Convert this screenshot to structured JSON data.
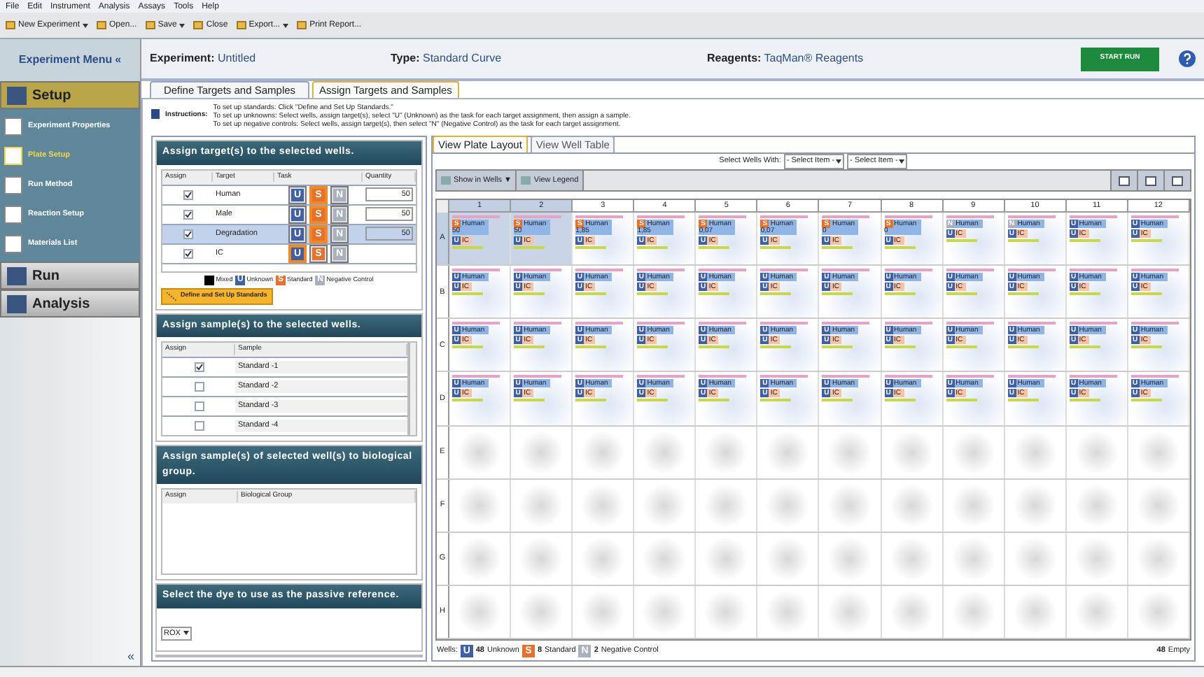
{
  "menu_bar": [
    "File",
    "Edit",
    "Instrument",
    "Analysis",
    "Assays",
    "Tools",
    "Help"
  ],
  "toolbar": [
    {
      "label": "New Experiment",
      "dropdown": true
    },
    {
      "label": "Open...",
      "dropdown": false
    },
    {
      "label": "Save",
      "dropdown": true
    },
    {
      "label": "Close",
      "dropdown": false
    },
    {
      "label": "Export...",
      "dropdown": true
    },
    {
      "label": "Print Report...",
      "dropdown": false
    }
  ],
  "sidebar": {
    "title": "Experiment Menu",
    "collapse": "«",
    "sections": [
      {
        "label": "Setup",
        "expanded": true,
        "items": [
          {
            "label": "Experiment Properties",
            "selected": false
          },
          {
            "label": "Plate Setup",
            "selected": true
          },
          {
            "label": "Run Method",
            "selected": false
          },
          {
            "label": "Reaction Setup",
            "selected": false
          },
          {
            "label": "Materials List",
            "selected": false
          }
        ]
      },
      {
        "label": "Run",
        "expanded": false
      },
      {
        "label": "Analysis",
        "expanded": false
      }
    ],
    "bottom_collapse": "«"
  },
  "header": {
    "experiment_label": "Experiment:",
    "experiment": "Untitled",
    "type_label": "Type:",
    "type": "Standard Curve",
    "reagents_label": "Reagents:",
    "reagents": "TaqMan® Reagents",
    "start_button": "START RUN"
  },
  "tabs": [
    {
      "label": "Define Targets and Samples",
      "selected": false
    },
    {
      "label": "Assign Targets and Samples",
      "selected": true
    }
  ],
  "instructions": {
    "label": "Instructions:",
    "lines": [
      "To set up standards: Click \"Define and Set Up Standards.\"",
      "To set up unknowns: Select wells, assign target(s), select \"U\" (Unknown) as the task for each target assignment, then assign a sample.",
      "To set up negative controls: Select wells, assign target(s), then select \"N\" (Negative Control) as the task for each target assignment."
    ]
  },
  "targets": {
    "title": "Assign target(s) to the selected wells.",
    "columns": [
      "Assign",
      "Target",
      "Task",
      "Quantity"
    ],
    "rows": [
      {
        "checked": true,
        "target": "Human",
        "tasks": [
          {
            "letter": "U",
            "selected": false
          },
          {
            "letter": "S",
            "selected": true
          },
          {
            "letter": "N",
            "selected": false
          }
        ],
        "quantity": "50",
        "selected": false
      },
      {
        "checked": true,
        "target": "Male",
        "tasks": [
          {
            "letter": "U",
            "selected": false
          },
          {
            "letter": "S",
            "selected": true
          },
          {
            "letter": "N",
            "selected": false
          }
        ],
        "quantity": "50",
        "selected": false
      },
      {
        "checked": true,
        "target": "Degradation",
        "tasks": [
          {
            "letter": "U",
            "selected": false
          },
          {
            "letter": "S",
            "selected": true
          },
          {
            "letter": "N",
            "selected": false
          }
        ],
        "quantity": "50",
        "selected": true
      },
      {
        "checked": true,
        "target": "IC",
        "tasks": [
          {
            "letter": "U",
            "selected": true
          },
          {
            "letter": "S",
            "selected": false
          },
          {
            "letter": "N",
            "selected": false
          }
        ],
        "selected": false
      }
    ],
    "legend": [
      {
        "kind": "mixed",
        "label": "Mixed"
      },
      {
        "kind": "U",
        "letter": "U",
        "label": "Unknown"
      },
      {
        "kind": "S",
        "letter": "S",
        "label": "Standard"
      },
      {
        "kind": "N",
        "letter": "N",
        "label": "Negative Control"
      }
    ],
    "button": "Define and Set Up Standards"
  },
  "samples": {
    "title": "Assign sample(s) to the selected wells.",
    "columns": [
      "Assign",
      "Sample"
    ],
    "rows": [
      {
        "checked": true,
        "sample": "Standard -1"
      },
      {
        "checked": false,
        "sample": "Standard -2"
      },
      {
        "checked": false,
        "sample": "Standard -3"
      },
      {
        "checked": false,
        "sample": "Standard -4"
      }
    ]
  },
  "bio_group": {
    "title": "Assign sample(s) of selected well(s) to biological group.",
    "columns": [
      "Assign",
      "Biological Group"
    ]
  },
  "dye": {
    "title": "Select the dye to use as the passive reference.",
    "value": "ROX"
  },
  "plate_tabs": [
    {
      "label": "View Plate Layout",
      "selected": true
    },
    {
      "label": "View Well Table",
      "selected": false
    }
  ],
  "select_wells": {
    "label": "Select Wells With:",
    "dropdowns": [
      "- Select Item -",
      "- Select Item -"
    ]
  },
  "plate_toolbar": [
    "Show in Wells ▼",
    "View Legend"
  ],
  "plate": {
    "columns": [
      {
        "label": "1",
        "selected": true
      },
      {
        "label": "2",
        "selected": true
      },
      {
        "label": "3",
        "selected": false
      },
      {
        "label": "4",
        "selected": false
      },
      {
        "label": "5",
        "selected": false
      },
      {
        "label": "6",
        "selected": false
      },
      {
        "label": "7",
        "selected": false
      },
      {
        "label": "8",
        "selected": false
      },
      {
        "label": "9",
        "selected": false
      },
      {
        "label": "10",
        "selected": false
      },
      {
        "label": "11",
        "selected": false
      },
      {
        "label": "12",
        "selected": false
      }
    ],
    "rows": [
      {
        "label": "A",
        "selected": true,
        "wells": [
          {
            "task": "S",
            "target": "Human",
            "quantity": "50",
            "task2": "U",
            "target2": "IC",
            "selected": true
          },
          {
            "task": "S",
            "target": "Human",
            "quantity": "50",
            "task2": "U",
            "target2": "IC",
            "selected": true
          },
          {
            "task": "S",
            "target": "Human",
            "quantity": "1,85",
            "task2": "U",
            "target2": "IC",
            "selected": false
          },
          {
            "task": "S",
            "target": "Human",
            "quantity": "1,85",
            "task2": "U",
            "target2": "IC",
            "selected": false
          },
          {
            "task": "S",
            "target": "Human",
            "quantity": "0,07",
            "task2": "U",
            "target2": "IC",
            "selected": false
          },
          {
            "task": "S",
            "target": "Human",
            "quantity": "0,07",
            "task2": "U",
            "target2": "IC",
            "selected": false
          },
          {
            "task": "S",
            "target": "Human",
            "quantity": "0",
            "task2": "U",
            "target2": "IC",
            "selected": false
          },
          {
            "task": "S",
            "target": "Human",
            "quantity": "0",
            "task2": "U",
            "target2": "IC",
            "selected": false
          },
          {
            "task": "N",
            "target": "Human",
            "task2": "U",
            "target2": "IC",
            "selected": false
          },
          {
            "task": "N",
            "target": "Human",
            "task2": "U",
            "target2": "IC",
            "selected": false
          },
          {
            "task": "U",
            "target": "Human",
            "task2": "U",
            "target2": "IC",
            "selected": false
          },
          {
            "task": "U",
            "target": "Human",
            "task2": "U",
            "target2": "IC",
            "selected": false
          }
        ]
      },
      {
        "label": "B",
        "selected": false,
        "wells": [
          {
            "task": "U",
            "target": "Human",
            "task2": "U",
            "target2": "IC",
            "selected": false
          },
          {
            "task": "U",
            "target": "Human",
            "task2": "U",
            "target2": "IC",
            "selected": false
          },
          {
            "task": "U",
            "target": "Human",
            "task2": "U",
            "target2": "IC",
            "selected": false
          },
          {
            "task": "U",
            "target": "Human",
            "task2": "U",
            "target2": "IC",
            "selected": false
          },
          {
            "task": "U",
            "target": "Human",
            "task2": "U",
            "target2": "IC",
            "selected": false
          },
          {
            "task": "U",
            "target": "Human",
            "task2": "U",
            "target2": "IC",
            "selected": false
          },
          {
            "task": "U",
            "target": "Human",
            "task2": "U",
            "target2": "IC",
            "selected": false
          },
          {
            "task": "U",
            "target": "Human",
            "task2": "U",
            "target2": "IC",
            "selected": false
          },
          {
            "task": "U",
            "target": "Human",
            "task2": "U",
            "target2": "IC",
            "selected": false
          },
          {
            "task": "U",
            "target": "Human",
            "task2": "U",
            "target2": "IC",
            "selected": false
          },
          {
            "task": "U",
            "target": "Human",
            "task2": "U",
            "target2": "IC",
            "selected": false
          },
          {
            "task": "U",
            "target": "Human",
            "task2": "U",
            "target2": "IC",
            "selected": false
          }
        ]
      },
      {
        "label": "C",
        "selected": false,
        "wells": [
          {
            "task": "U",
            "target": "Human",
            "task2": "U",
            "target2": "IC",
            "selected": false
          },
          {
            "task": "U",
            "target": "Human",
            "task2": "U",
            "target2": "IC",
            "selected": false
          },
          {
            "task": "U",
            "target": "Human",
            "task2": "U",
            "target2": "IC",
            "selected": false
          },
          {
            "task": "U",
            "target": "Human",
            "task2": "U",
            "target2": "IC",
            "selected": false
          },
          {
            "task": "U",
            "target": "Human",
            "task2": "U",
            "target2": "IC",
            "selected": false
          },
          {
            "task": "U",
            "target": "Human",
            "task2": "U",
            "target2": "IC",
            "selected": false
          },
          {
            "task": "U",
            "target": "Human",
            "task2": "U",
            "target2": "IC",
            "selected": false
          },
          {
            "task": "U",
            "target": "Human",
            "task2": "U",
            "target2": "IC",
            "selected": false
          },
          {
            "task": "U",
            "target": "Human",
            "task2": "U",
            "target2": "IC",
            "selected": false
          },
          {
            "task": "U",
            "target": "Human",
            "task2": "U",
            "target2": "IC",
            "selected": false
          },
          {
            "task": "U",
            "target": "Human",
            "task2": "U",
            "target2": "IC",
            "selected": false
          },
          {
            "task": "U",
            "target": "Human",
            "task2": "U",
            "target2": "IC",
            "selected": false
          }
        ]
      },
      {
        "label": "D",
        "selected": false,
        "wells": [
          {
            "task": "U",
            "target": "Human",
            "task2": "U",
            "target2": "IC",
            "selected": false
          },
          {
            "task": "U",
            "target": "Human",
            "task2": "U",
            "target2": "IC",
            "selected": false
          },
          {
            "task": "U",
            "target": "Human",
            "task2": "U",
            "target2": "IC",
            "selected": false
          },
          {
            "task": "U",
            "target": "Human",
            "task2": "U",
            "target2": "IC",
            "selected": false
          },
          {
            "task": "U",
            "target": "Human",
            "task2": "U",
            "target2": "IC",
            "selected": false
          },
          {
            "task": "U",
            "target": "Human",
            "task2": "U",
            "target2": "IC",
            "selected": false
          },
          {
            "task": "U",
            "target": "Human",
            "task2": "U",
            "target2": "IC",
            "selected": false
          },
          {
            "task": "U",
            "target": "Human",
            "task2": "U",
            "target2": "IC",
            "selected": false
          },
          {
            "task": "U",
            "target": "Human",
            "task2": "U",
            "target2": "IC",
            "selected": false
          },
          {
            "task": "U",
            "target": "Human",
            "task2": "U",
            "target2": "IC",
            "selected": false
          },
          {
            "task": "U",
            "target": "Human",
            "task2": "U",
            "target2": "IC",
            "selected": false
          },
          {
            "task": "U",
            "target": "Human",
            "task2": "U",
            "target2": "IC",
            "selected": false
          }
        ]
      },
      {
        "label": "E",
        "selected": false,
        "wells": []
      },
      {
        "label": "F",
        "selected": false,
        "wells": []
      },
      {
        "label": "G",
        "selected": false,
        "wells": []
      },
      {
        "label": "H",
        "selected": false,
        "wells": []
      }
    ]
  },
  "plate_footer": {
    "label": "Wells:",
    "counts": [
      {
        "letter": "U",
        "count": "48",
        "label": "Unknown"
      },
      {
        "letter": "S",
        "count": "8",
        "label": "Standard"
      },
      {
        "letter": "N",
        "count": "2",
        "label": "Negative Control"
      }
    ],
    "empty_count": "48",
    "empty_label": "Empty"
  }
}
